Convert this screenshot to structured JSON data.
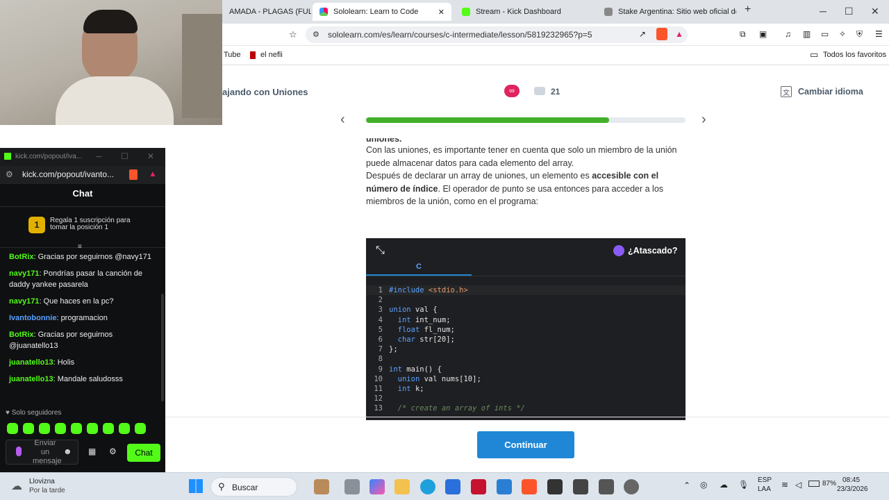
{
  "browser": {
    "tabs": [
      {
        "label": "AMADA - PLAGAS (FULL A"
      },
      {
        "label": "Sololearn: Learn to Code",
        "active": true
      },
      {
        "label": "Stream - Kick Dashboard"
      },
      {
        "label": "Stake Argentina: Sitio web oficial de"
      }
    ],
    "url": "sololearn.com/es/learn/courses/c-intermediate/lesson/5819232965?p=5",
    "bookmarks": [
      "Tube",
      "el nefli"
    ],
    "favorites_label": "Todos los favoritos"
  },
  "lesson": {
    "title": "ajando con Uniones",
    "comments": "21",
    "change_language": "Cambiar idioma",
    "progress": 0.76,
    "partial_top": "uniones.",
    "p1": "Con las uniones, es importante tener en cuenta que solo un miembro de la unión puede almacenar datos para cada elemento del array.",
    "p2_a": "Después de declarar un array de uniones, un elemento es ",
    "p2_b": "accesible con el número de índice",
    "p2_c": ". El operador de punto se usa entonces para acceder a los miembros de la unión, como en el programa:",
    "stuck": "¿Atascado?",
    "lang_tab": "C",
    "continue": "Continuar",
    "code": [
      {
        "n": "1",
        "t": "#include <stdio.h>"
      },
      {
        "n": "2",
        "t": ""
      },
      {
        "n": "3",
        "t": "union val {"
      },
      {
        "n": "4",
        "t": "  int int_num;"
      },
      {
        "n": "5",
        "t": "  float fl_num;"
      },
      {
        "n": "6",
        "t": "  char str[20];"
      },
      {
        "n": "7",
        "t": "};"
      },
      {
        "n": "8",
        "t": ""
      },
      {
        "n": "9",
        "t": "int main() {"
      },
      {
        "n": "10",
        "t": "  union val nums[10];"
      },
      {
        "n": "11",
        "t": "  int k;"
      },
      {
        "n": "12",
        "t": ""
      },
      {
        "n": "13",
        "t": "  /* create an array of ints */"
      }
    ]
  },
  "kick": {
    "titlebar": "kick.com/popout/iva...",
    "url": "kick.com/popout/ivanto...",
    "chat_title": "Chat",
    "sub_text": "Regala 1 suscripción para tomar la posición 1",
    "badge_num": "1",
    "messages": [
      {
        "user": "BotRix",
        "text": "Gracias por seguirnos @navy171"
      },
      {
        "user": "navy171",
        "text": "Pondrías pasar la canción de daddy yankee pasarela"
      },
      {
        "user": "navy171",
        "text": "Que haces en la pc?"
      },
      {
        "user": "Ivantobonnie",
        "text": "programacion"
      },
      {
        "user": "BotRix",
        "text": "Gracias por seguirnos @juanatello13"
      },
      {
        "user": "juanatello13",
        "text": "Holis"
      },
      {
        "user": "juanatello13",
        "text": "Mandale saludosss"
      }
    ],
    "followers_only": "Solo seguidores",
    "input_placeholder": "Enviar un mensaje",
    "send": "Chat"
  },
  "taskbar": {
    "weather_temp": "Llovizna",
    "weather_sub": "Por la tarde",
    "search": "Buscar",
    "lang1": "ESP",
    "lang2": "LAA",
    "battery": "87%",
    "time": "08:45",
    "date": "23/3/2026"
  },
  "colors": {
    "accent": "#1f87d6",
    "progress": "#43b02a",
    "kick_green": "#53fc18",
    "heart": "#e0245e"
  }
}
